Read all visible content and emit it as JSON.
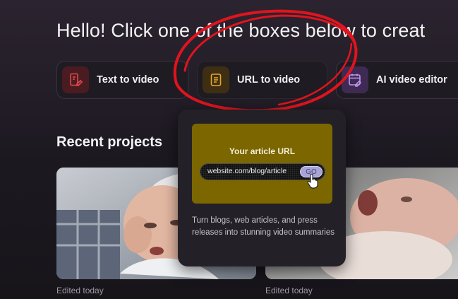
{
  "header": {
    "greeting": "Hello! Click one of the boxes below to creat"
  },
  "options": [
    {
      "label": "Text to video",
      "icon": "text-file-edit-icon",
      "color": "#e0484a"
    },
    {
      "label": "URL to video",
      "icon": "document-icon",
      "color": "#e5a52b"
    },
    {
      "label": "AI video editor",
      "icon": "calendar-edit-icon",
      "color": "#b686e6"
    }
  ],
  "recent": {
    "title": "Recent projects",
    "items": [
      {
        "edited": "Edited today",
        "thumbnail": "newborn baby photo"
      },
      {
        "edited": "Edited today",
        "thumbnail": "crying newborn photo"
      }
    ]
  },
  "popover": {
    "media_title": "Your article URL",
    "url_example": "website.com/blog/article",
    "go_label": "GO",
    "description": "Turn blogs, web articles, and press releases into stunning video summaries"
  },
  "colors": {
    "annotation_red": "#e0141e",
    "popover_media": "#7b6600",
    "go_button": "#a9a4d6"
  }
}
